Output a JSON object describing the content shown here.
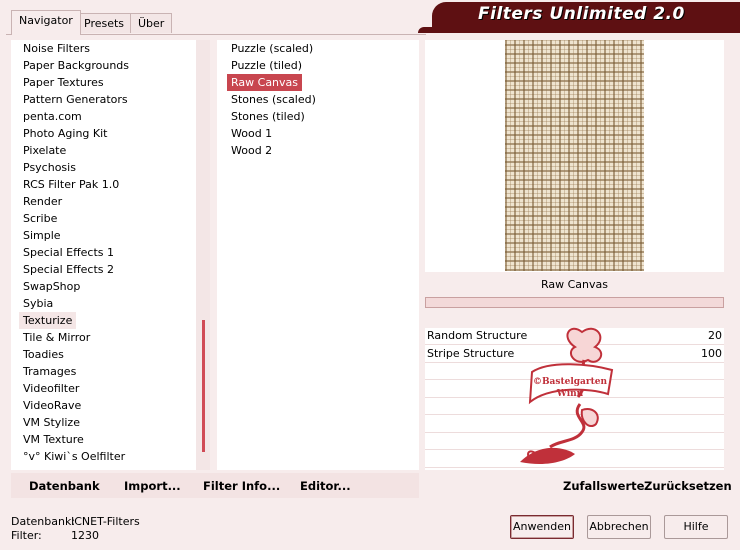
{
  "tabs": [
    "Navigator",
    "Presets",
    "Über"
  ],
  "window_title": "Filters Unlimited 2.0",
  "categories": [
    "Noise Filters",
    "Paper Backgrounds",
    "Paper Textures",
    "Pattern Generators",
    "penta.com",
    "Photo Aging Kit",
    "Pixelate",
    "Psychosis",
    "RCS Filter Pak 1.0",
    "Render",
    "Scribe",
    "Simple",
    "Special Effects 1",
    "Special Effects 2",
    "SwapShop",
    "Sybia",
    "Texturize",
    "Tile & Mirror",
    "Toadies",
    "Tramages",
    "Videofilter",
    "VideoRave",
    "VM Stylize",
    "VM Texture",
    "°v° Kiwi`s Oelfilter"
  ],
  "selected_category_index": 16,
  "filters": [
    "Puzzle (scaled)",
    "Puzzle (tiled)",
    "Raw Canvas",
    "Stones (scaled)",
    "Stones (tiled)",
    "Wood 1",
    "Wood 2"
  ],
  "selected_filter_index": 2,
  "preview": {
    "filter_name": "Raw Canvas"
  },
  "params": [
    {
      "label": "Random Structure",
      "value": "20"
    },
    {
      "label": "Stripe Structure",
      "value": "100"
    }
  ],
  "watermark": {
    "line1": "©Bastelgarten",
    "line2": "Winn"
  },
  "actions": {
    "database": "Datenbank",
    "import": "Import...",
    "filter_info": "Filter Info...",
    "editor": "Editor...",
    "random": "Zufallswerte",
    "reset": "Zurücksetzen"
  },
  "status": {
    "db_label": "Datenbank:",
    "db_value": "ICNET-Filters",
    "filter_label": "Filter:",
    "filter_value": "1230"
  },
  "buttons": {
    "apply": "Anwenden",
    "cancel": "Abbrechen",
    "help": "Hilfe"
  },
  "colors": {
    "accent": "#5e1012",
    "selection": "#c8464f",
    "background": "#f7ecec"
  }
}
